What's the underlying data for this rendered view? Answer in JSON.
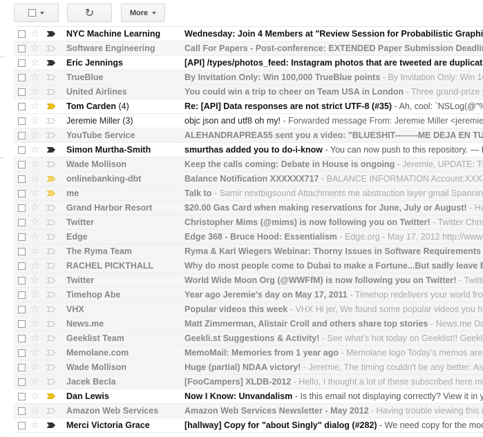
{
  "toolbar": {
    "refresh_glyph": "↻",
    "more_label": "More"
  },
  "colors": {
    "important_yellow": "#f3c21b",
    "important_dark": "#333333",
    "selected_bar": "#4d90fe"
  },
  "emails": [
    {
      "sender": "NYC Machine Learning",
      "count": "",
      "subject": "Wednesday: Join 4 Members at \"Review Session for Probabilistic Graphical",
      "snippet": "",
      "state": "unread",
      "important": "dark"
    },
    {
      "sender": "Software Engineering",
      "count": "",
      "subject": "Call For Papers - Post-conference: EXTENDED Paper Submission Deadline:",
      "snippet": "",
      "state": "read",
      "important": "outline"
    },
    {
      "sender": "Eric Jennings",
      "count": "",
      "subject": "[API] /types/photos_feed: Instagram photos that are tweeted are duplicated i",
      "snippet": "",
      "state": "unread",
      "important": "dark"
    },
    {
      "sender": "TrueBlue",
      "count": "",
      "subject": "By Invitation Only: Win 100,000 TrueBlue points",
      "snippet": " - By Invitation Only: Win 1000",
      "state": "read",
      "important": "outline"
    },
    {
      "sender": "United Airlines",
      "count": "",
      "subject": "You could win a trip to cheer on Team USA in London",
      "snippet": " - Three grand-prize winn",
      "state": "read",
      "important": "outline"
    },
    {
      "sender": "Tom Carden",
      "count": "(4)",
      "subject": "Re: [API] Data responses are not strict UTF-8 (#35)",
      "snippet": " - Ah, cool: `NSLog(@\"%@",
      "state": "unread",
      "important": "yellow"
    },
    {
      "sender": "Jeremie Miller",
      "count": "(3)",
      "subject": "objc json and utf8 oh my!",
      "snippet": " - Forwarded message From: Jeremie Miller <jeremie@",
      "state": "plain",
      "important": "outline"
    },
    {
      "sender": "YouTube Service",
      "count": "",
      "subject": "ALEHANDRAPREA55 sent you a video: \"BLUESHIT--------ME DEJA EN TUS",
      "snippet": "",
      "state": "read",
      "important": "outline"
    },
    {
      "sender": "Simon Murtha-Smith",
      "count": "",
      "subject": "smurthas added you to do-i-know",
      "snippet": " - You can now push to this repository. — Rep",
      "state": "unread",
      "important": "dark"
    },
    {
      "sender": "Wade Mollison",
      "count": "",
      "subject": "Keep the calls coming: Debate in House is ongoing",
      "snippet": " - Jeremie, UPDATE: They'",
      "state": "read",
      "important": "outline"
    },
    {
      "sender": "onlinebanking-dbt",
      "count": "",
      "subject": "Balance Notification XXXXXX717",
      "snippet": " - BALANCE INFORMATION Account:XXXXXX",
      "state": "read",
      "important": "yellow-faded"
    },
    {
      "sender": "me",
      "count": "",
      "subject": "Talk to",
      "snippet": " - Samir nextbigsound Attachments me abstraction layer gmail Spanning",
      "state": "read",
      "important": "yellow-faded"
    },
    {
      "sender": "Grand Harbor Resort",
      "count": "",
      "subject": "$20.00 Gas Card when making reservations for June, July or August!",
      "snippet": " - Havin",
      "state": "read",
      "important": "outline"
    },
    {
      "sender": "Twitter",
      "count": "",
      "subject": "Christopher Mims (@mims) is now following you on Twitter!",
      "snippet": " - Twitter Christop",
      "state": "read",
      "important": "outline"
    },
    {
      "sender": "Edge",
      "count": "",
      "subject": "Edge 368 - Bruce Hood: Essentialism",
      "snippet": " - Edge.org - May 17, 2012 http://www.ed",
      "state": "read",
      "important": "outline"
    },
    {
      "sender": "The Ryma Team",
      "count": "",
      "subject": "Ryma & Karl Wiegers Webinar: Thorny Issues in Software Requirements",
      "snippet": " - Can",
      "state": "read",
      "important": "outline"
    },
    {
      "sender": "RACHEL PICKTHALL",
      "count": "",
      "subject": "Why do most people come to Dubai to make a Fortune...But sadly leave Brok",
      "snippet": "",
      "state": "read",
      "important": "outline"
    },
    {
      "sender": "Twitter",
      "count": "",
      "subject": "World Wide Moon Org (@WWFfM) is now following you on Twitter!",
      "snippet": " - Twitter Wo",
      "state": "read",
      "important": "outline"
    },
    {
      "sender": "Timehop Abe",
      "count": "",
      "subject": "Year ago Jeremie's day on May 17, 2011",
      "snippet": " - Timehop redelivers your world from",
      "state": "read",
      "important": "outline"
    },
    {
      "sender": "VHX",
      "count": "",
      "subject": "Popular videos this week",
      "snippet": " - VHX Hi jer, We found some popular videos you have",
      "state": "read",
      "important": "outline"
    },
    {
      "sender": "News.me",
      "count": "",
      "subject": "Matt Zimmerman, Alistair Croll and others share top stories",
      "snippet": " - News.me Daily",
      "state": "read",
      "important": "outline"
    },
    {
      "sender": "Geeklist Team",
      "count": "",
      "subject": "Geekli.st Suggestions & Activity!",
      "snippet": " - See what's hot today on Geeklist!! Geeklist",
      "state": "read",
      "important": "outline"
    },
    {
      "sender": "Memolane.com",
      "count": "",
      "subject": "MemoMail: Memories from 1 year ago",
      "snippet": " - Memolane logo Today's memos are fr",
      "state": "read",
      "important": "outline"
    },
    {
      "sender": "Wade Mollison",
      "count": "",
      "subject": "Huge (partial) NDAA victory!",
      "snippet": " - Jeremie, The timing couldn't be any better: As C",
      "state": "read",
      "important": "outline"
    },
    {
      "sender": "Jacek Becla",
      "count": "",
      "subject": "[FooCampers] XLDB-2012",
      "snippet": " - Hello, I thought a lot of these subscribed here migh",
      "state": "read",
      "important": "outline"
    },
    {
      "sender": "Dan Lewis",
      "count": "",
      "subject": "Now I Know: Unvandalism",
      "snippet": " - Is this email not displaying correctly? View it in you",
      "state": "unread",
      "important": "yellow"
    },
    {
      "sender": "Amazon Web Services",
      "count": "",
      "subject": "Amazon Web Services Newsletter - May 2012",
      "snippet": " - Having trouble viewing this m",
      "state": "read",
      "important": "outline"
    },
    {
      "sender": "Merci Victoria Grace",
      "count": "",
      "subject": "[hallway] Copy for \"about Singly\" dialog (#282)",
      "snippet": " - We need copy for the modal t",
      "state": "unread",
      "important": "dark"
    }
  ]
}
